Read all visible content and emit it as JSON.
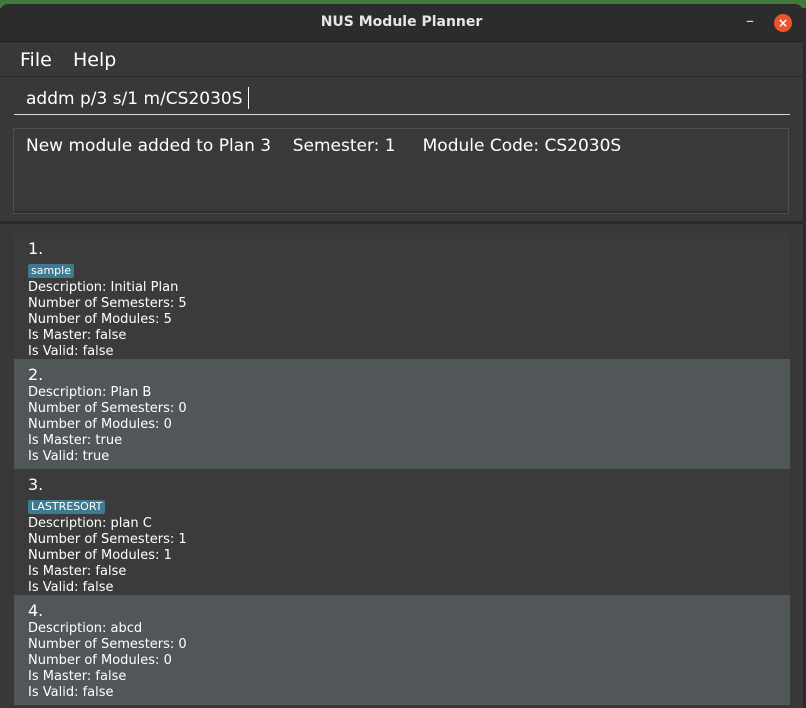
{
  "window": {
    "title": "NUS Module Planner",
    "minimize_glyph": "–",
    "close_glyph": "×"
  },
  "menu": {
    "items": [
      {
        "label": "File"
      },
      {
        "label": "Help"
      }
    ]
  },
  "command": {
    "value": "addm p/3 s/1 m/CS2030S"
  },
  "result": {
    "text": "New module added to Plan 3    Semester: 1     Module Code: CS2030S"
  },
  "plans": [
    {
      "index": "1.",
      "tag": "sample",
      "description": "Description: Initial Plan",
      "semesters": "Number of Semesters: 5",
      "modules": "Number of Modules: 5",
      "master": "Is Master: false",
      "valid": "Is Valid: false"
    },
    {
      "index": "2.",
      "tag": "",
      "description": "Description: Plan B",
      "semesters": "Number of Semesters: 0",
      "modules": "Number of Modules: 0",
      "master": "Is Master: true",
      "valid": "Is Valid: true"
    },
    {
      "index": "3.",
      "tag": "LASTRESORT",
      "description": "Description: plan C",
      "semesters": "Number of Semesters: 1",
      "modules": "Number of Modules: 1",
      "master": "Is Master: false",
      "valid": "Is Valid: false"
    },
    {
      "index": "4.",
      "tag": "",
      "description": "Description: abcd",
      "semesters": "Number of Semesters: 0",
      "modules": "Number of Modules: 0",
      "master": "Is Master: false",
      "valid": "Is Valid: false"
    }
  ],
  "colors": {
    "tag_background": "#3e7b91",
    "close_button": "#e9552b",
    "card_dark": "#3b3b3b",
    "card_light": "#515759"
  }
}
